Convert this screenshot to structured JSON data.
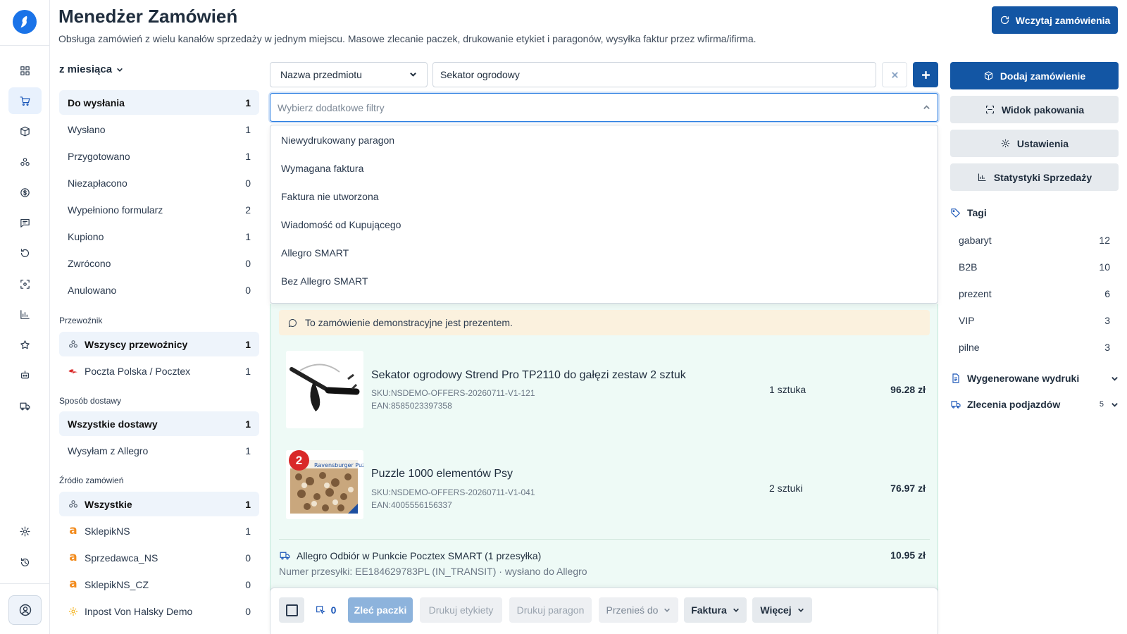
{
  "header": {
    "title": "Menedżer Zamówień",
    "subtitle": "Obsługa zamówień z wielu kanałów sprzedaży w jednym miejscu. Masowe zlecanie paczek, drukowanie etykiet i paragonów, wysyłka faktur przez wfirma/ifirma.",
    "load_button": "Wczytaj zamówienia"
  },
  "rail": {
    "icons": [
      "dashboard-icon",
      "cart-icon",
      "box-icon",
      "network-icon",
      "dollar-icon",
      "chat-icon",
      "refresh-icon",
      "scan-icon",
      "chart-icon",
      "star-icon",
      "robot-icon",
      "truck-icon",
      "settings-icon",
      "history-icon",
      "user-icon"
    ]
  },
  "left": {
    "period": "z miesiąca",
    "statuses": [
      {
        "label": "Do wysłania",
        "count": "1"
      },
      {
        "label": "Wysłano",
        "count": "1"
      },
      {
        "label": "Przygotowano",
        "count": "1"
      },
      {
        "label": "Niezapłacono",
        "count": "0"
      },
      {
        "label": "Wypełniono formularz",
        "count": "2"
      },
      {
        "label": "Kupiono",
        "count": "1"
      },
      {
        "label": "Zwrócono",
        "count": "0"
      },
      {
        "label": "Anulowano",
        "count": "0"
      }
    ],
    "carrier_header": "Przewoźnik",
    "carriers": [
      {
        "label": "Wszyscy przewoźnicy",
        "count": "1"
      },
      {
        "label": "Poczta Polska / Pocztex",
        "count": "1"
      }
    ],
    "delivery_header": "Sposób dostawy",
    "deliveries": [
      {
        "label": "Wszystkie dostawy",
        "count": "1"
      },
      {
        "label": "Wysyłam z Allegro",
        "count": "1"
      }
    ],
    "source_header": "Źródło zamówień",
    "sources": [
      {
        "label": "Wszystkie",
        "count": "1"
      },
      {
        "label": "SklepikNS",
        "count": "1"
      },
      {
        "label": "Sprzedawca_NS",
        "count": "0"
      },
      {
        "label": "SklepikNS_CZ",
        "count": "0"
      },
      {
        "label": "Inpost Von Halsky Demo",
        "count": "0"
      }
    ]
  },
  "search": {
    "field_select": "Nazwa przedmiotu",
    "query": "Sekator ogrodowy",
    "filter_placeholder": "Wybierz dodatkowe filtry",
    "filter_options": [
      "Niewydrukowany paragon",
      "Wymagana faktura",
      "Faktura nie utworzona",
      "Wiadomość od Kupującego",
      "Allegro SMART",
      "Bez Allegro SMART"
    ]
  },
  "order": {
    "note": "To zamówienie demonstracyjne jest prezentem.",
    "items": [
      {
        "title": "Sekator ogrodowy Strend Pro TP2110 do gałęzi zestaw 2 sztuk",
        "sku": "SKU:NSDEMO-OFFERS-20260711-V1-121",
        "ean": "EAN:8585023397358",
        "qty": "1 sztuka",
        "price": "96.28 zł"
      },
      {
        "title": "Puzzle 1000 elementów Psy",
        "sku": "SKU:NSDEMO-OFFERS-20260711-V1-041",
        "ean": "EAN:4005556156337",
        "qty": "2 sztuki",
        "price": "76.97 zł",
        "badge": "2",
        "thumb_text": "Ravensburger Puzzle"
      }
    ],
    "shipping": {
      "label": "Allegro Odbiór w Punkcie Pocztex SMART (1 przesyłka)",
      "price": "10.95 zł",
      "tracking": "Numer przesyłki: EE184629783PL (IN_TRANSIT) · wysłano do Allegro"
    }
  },
  "bottombar": {
    "selected_count": "0",
    "order_parcels": "Zleć paczki",
    "print_labels": "Drukuj etykiety",
    "print_receipt": "Drukuj paragon",
    "move_to": "Przenieś do",
    "invoice": "Faktura",
    "more": "Więcej"
  },
  "right": {
    "add_order": "Dodaj zamówienie",
    "packing_view": "Widok pakowania",
    "settings": "Ustawienia",
    "sales_stats": "Statystyki Sprzedaży",
    "tags_title": "Tagi",
    "tags": [
      {
        "label": "gabaryt",
        "count": "12"
      },
      {
        "label": "B2B",
        "count": "10"
      },
      {
        "label": "prezent",
        "count": "6"
      },
      {
        "label": "VIP",
        "count": "3"
      },
      {
        "label": "pilne",
        "count": "3"
      }
    ],
    "printouts": "Wygenerowane wydruki",
    "pickups": "Zlecenia podjazdów",
    "pickups_count": "5"
  },
  "colors": {
    "primary": "#1356a4",
    "selected_bg": "#eef4fb",
    "order_bg": "#eefaf6",
    "note_bg": "#fbf1de",
    "badge": "#d92828"
  }
}
